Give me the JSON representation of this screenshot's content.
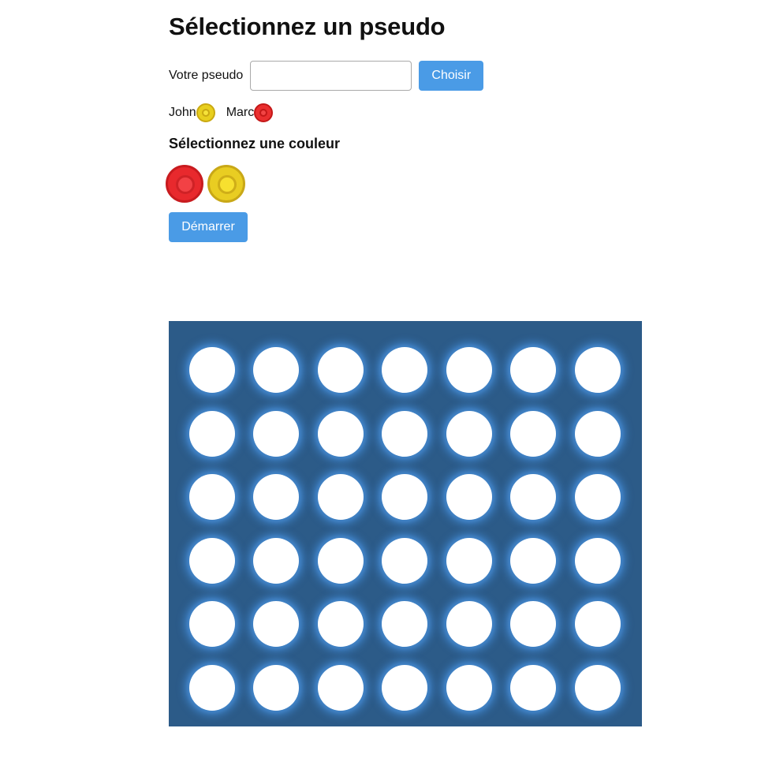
{
  "heading": "Sélectionnez un pseudo",
  "pseudo": {
    "label": "Votre pseudo",
    "value": "",
    "placeholder": "",
    "button_label": "Choisir"
  },
  "players": [
    {
      "name": "John",
      "color": "yellow",
      "color_hex": "#e8cf1e"
    },
    {
      "name": "Marc",
      "color": "red",
      "color_hex": "#ea2f2f"
    }
  ],
  "color_section": {
    "heading": "Sélectionnez une couleur",
    "options": [
      {
        "name": "red",
        "hex": "#e8292d"
      },
      {
        "name": "yellow",
        "hex": "#e9cd22"
      }
    ]
  },
  "start_button": "Démarrer",
  "board": {
    "rows": 6,
    "columns": 7,
    "background": "#2c5b88",
    "cells": "empty"
  }
}
